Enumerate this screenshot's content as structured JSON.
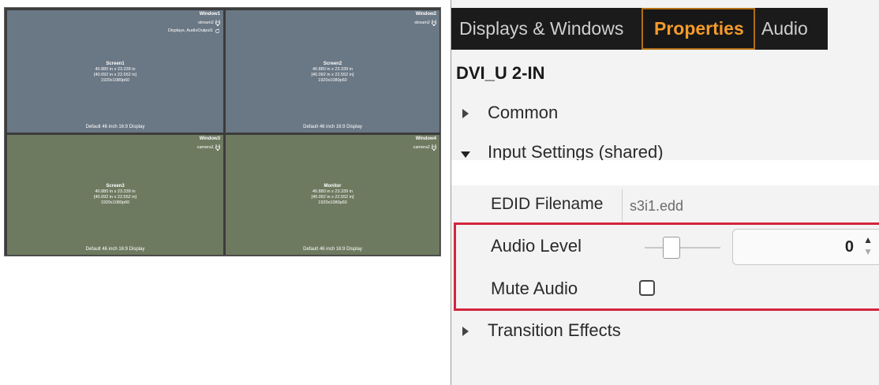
{
  "display_wall": {
    "cells": [
      {
        "window_title": "Window1",
        "window_lines": [
          {
            "text": "stream2",
            "icon": "plug-icon"
          },
          {
            "text": "Displays, AudioOutput1",
            "icon": "refresh-icon"
          }
        ],
        "screen_name": "Screen1",
        "size_in": "40.880 in x 23.339 in",
        "size_bracket": "[40.092 in x 22.552 in]",
        "resolution": "1920x1080p60",
        "display_type": "Default 46 inch 16:9 Display",
        "color": "#6a7784"
      },
      {
        "window_title": "Window2",
        "window_lines": [
          {
            "text": "stream2",
            "icon": "plug-icon"
          }
        ],
        "screen_name": "Screen2",
        "size_in": "40.880 in x 23.339 in",
        "size_bracket": "[40.092 in x 22.552 in]",
        "resolution": "1920x1080p60",
        "display_type": "Default 46 inch 16:9 Display",
        "color": "#6a7784"
      },
      {
        "window_title": "Window3",
        "window_lines": [
          {
            "text": "camera1",
            "icon": "plug-icon"
          }
        ],
        "screen_name": "Screen3",
        "size_in": "40.880 in x 23.339 in",
        "size_bracket": "[40.092 in x 22.552 in]",
        "resolution": "1920x1080p60",
        "display_type": "Default 46 inch 16:9 Display",
        "color": "#6e7a60"
      },
      {
        "window_title": "Window4",
        "window_lines": [
          {
            "text": "camera2",
            "icon": "plug-icon"
          }
        ],
        "screen_name": "Monitor",
        "size_in": "40.880 in x 23.339 in",
        "size_bracket": "[40.092 in x 22.552 in]",
        "resolution": "1920x1080p60",
        "display_type": "Default 46 inch 16:9 Display",
        "color": "#6e7a60"
      }
    ]
  },
  "panel": {
    "tabs": [
      {
        "label": "Displays & Windows",
        "active": false
      },
      {
        "label": "Properties",
        "active": true
      },
      {
        "label": "Audio",
        "active": false
      }
    ],
    "title": "DVI_U 2-IN",
    "sections": {
      "common": "Common",
      "input_settings": "Input Settings (shared)",
      "transition_effects": "Transition Effects"
    },
    "edid": {
      "label": "EDID Filename",
      "value": "s3i1.edd"
    },
    "audio_level": {
      "label": "Audio Level",
      "value": "0",
      "slider_fraction": 0.35
    },
    "mute_audio": {
      "label": "Mute Audio",
      "checked": false
    },
    "colors": {
      "accent": "#f39a2c",
      "highlight": "#d4253d",
      "tab_bg": "#1b1b1b"
    }
  }
}
